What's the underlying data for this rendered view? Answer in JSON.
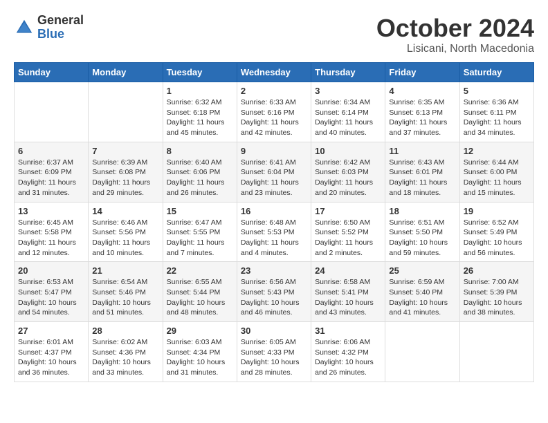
{
  "header": {
    "logo_general": "General",
    "logo_blue": "Blue",
    "month": "October 2024",
    "location": "Lisicani, North Macedonia"
  },
  "days_of_week": [
    "Sunday",
    "Monday",
    "Tuesday",
    "Wednesday",
    "Thursday",
    "Friday",
    "Saturday"
  ],
  "weeks": [
    [
      {
        "day": "",
        "info": ""
      },
      {
        "day": "",
        "info": ""
      },
      {
        "day": "1",
        "info": "Sunrise: 6:32 AM\nSunset: 6:18 PM\nDaylight: 11 hours\nand 45 minutes."
      },
      {
        "day": "2",
        "info": "Sunrise: 6:33 AM\nSunset: 6:16 PM\nDaylight: 11 hours\nand 42 minutes."
      },
      {
        "day": "3",
        "info": "Sunrise: 6:34 AM\nSunset: 6:14 PM\nDaylight: 11 hours\nand 40 minutes."
      },
      {
        "day": "4",
        "info": "Sunrise: 6:35 AM\nSunset: 6:13 PM\nDaylight: 11 hours\nand 37 minutes."
      },
      {
        "day": "5",
        "info": "Sunrise: 6:36 AM\nSunset: 6:11 PM\nDaylight: 11 hours\nand 34 minutes."
      }
    ],
    [
      {
        "day": "6",
        "info": "Sunrise: 6:37 AM\nSunset: 6:09 PM\nDaylight: 11 hours\nand 31 minutes."
      },
      {
        "day": "7",
        "info": "Sunrise: 6:39 AM\nSunset: 6:08 PM\nDaylight: 11 hours\nand 29 minutes."
      },
      {
        "day": "8",
        "info": "Sunrise: 6:40 AM\nSunset: 6:06 PM\nDaylight: 11 hours\nand 26 minutes."
      },
      {
        "day": "9",
        "info": "Sunrise: 6:41 AM\nSunset: 6:04 PM\nDaylight: 11 hours\nand 23 minutes."
      },
      {
        "day": "10",
        "info": "Sunrise: 6:42 AM\nSunset: 6:03 PM\nDaylight: 11 hours\nand 20 minutes."
      },
      {
        "day": "11",
        "info": "Sunrise: 6:43 AM\nSunset: 6:01 PM\nDaylight: 11 hours\nand 18 minutes."
      },
      {
        "day": "12",
        "info": "Sunrise: 6:44 AM\nSunset: 6:00 PM\nDaylight: 11 hours\nand 15 minutes."
      }
    ],
    [
      {
        "day": "13",
        "info": "Sunrise: 6:45 AM\nSunset: 5:58 PM\nDaylight: 11 hours\nand 12 minutes."
      },
      {
        "day": "14",
        "info": "Sunrise: 6:46 AM\nSunset: 5:56 PM\nDaylight: 11 hours\nand 10 minutes."
      },
      {
        "day": "15",
        "info": "Sunrise: 6:47 AM\nSunset: 5:55 PM\nDaylight: 11 hours\nand 7 minutes."
      },
      {
        "day": "16",
        "info": "Sunrise: 6:48 AM\nSunset: 5:53 PM\nDaylight: 11 hours\nand 4 minutes."
      },
      {
        "day": "17",
        "info": "Sunrise: 6:50 AM\nSunset: 5:52 PM\nDaylight: 11 hours\nand 2 minutes."
      },
      {
        "day": "18",
        "info": "Sunrise: 6:51 AM\nSunset: 5:50 PM\nDaylight: 10 hours\nand 59 minutes."
      },
      {
        "day": "19",
        "info": "Sunrise: 6:52 AM\nSunset: 5:49 PM\nDaylight: 10 hours\nand 56 minutes."
      }
    ],
    [
      {
        "day": "20",
        "info": "Sunrise: 6:53 AM\nSunset: 5:47 PM\nDaylight: 10 hours\nand 54 minutes."
      },
      {
        "day": "21",
        "info": "Sunrise: 6:54 AM\nSunset: 5:46 PM\nDaylight: 10 hours\nand 51 minutes."
      },
      {
        "day": "22",
        "info": "Sunrise: 6:55 AM\nSunset: 5:44 PM\nDaylight: 10 hours\nand 48 minutes."
      },
      {
        "day": "23",
        "info": "Sunrise: 6:56 AM\nSunset: 5:43 PM\nDaylight: 10 hours\nand 46 minutes."
      },
      {
        "day": "24",
        "info": "Sunrise: 6:58 AM\nSunset: 5:41 PM\nDaylight: 10 hours\nand 43 minutes."
      },
      {
        "day": "25",
        "info": "Sunrise: 6:59 AM\nSunset: 5:40 PM\nDaylight: 10 hours\nand 41 minutes."
      },
      {
        "day": "26",
        "info": "Sunrise: 7:00 AM\nSunset: 5:39 PM\nDaylight: 10 hours\nand 38 minutes."
      }
    ],
    [
      {
        "day": "27",
        "info": "Sunrise: 6:01 AM\nSunset: 4:37 PM\nDaylight: 10 hours\nand 36 minutes."
      },
      {
        "day": "28",
        "info": "Sunrise: 6:02 AM\nSunset: 4:36 PM\nDaylight: 10 hours\nand 33 minutes."
      },
      {
        "day": "29",
        "info": "Sunrise: 6:03 AM\nSunset: 4:34 PM\nDaylight: 10 hours\nand 31 minutes."
      },
      {
        "day": "30",
        "info": "Sunrise: 6:05 AM\nSunset: 4:33 PM\nDaylight: 10 hours\nand 28 minutes."
      },
      {
        "day": "31",
        "info": "Sunrise: 6:06 AM\nSunset: 4:32 PM\nDaylight: 10 hours\nand 26 minutes."
      },
      {
        "day": "",
        "info": ""
      },
      {
        "day": "",
        "info": ""
      }
    ]
  ]
}
